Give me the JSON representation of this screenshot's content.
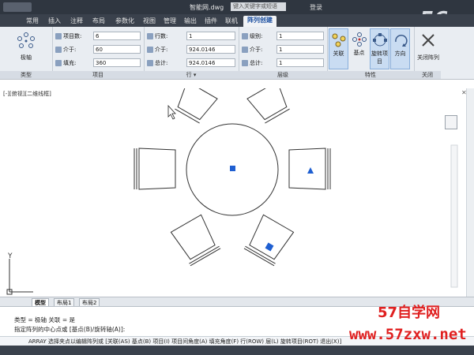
{
  "titlebar": {
    "doc_title": "智能网.dwg",
    "search_placeholder": "键入关键字或短语",
    "user_label": "登录"
  },
  "watermark_logo": {
    "num": "56",
    "text": "我乐"
  },
  "tabs": [
    "常用",
    "插入",
    "注释",
    "布局",
    "参数化",
    "视图",
    "管理",
    "输出",
    "插件",
    "联机",
    "阵列创建"
  ],
  "ribbon": {
    "type_group": {
      "label": "类型",
      "button": "极轴"
    },
    "items_group": {
      "label": "项目",
      "count_label": "项目数:",
      "count_value": "6",
      "between_label": "介于:",
      "between_value": "60",
      "fill_label": "填充:",
      "fill_value": "360"
    },
    "rows_group": {
      "label": "行 ▾",
      "rows_label": "行数:",
      "rows_value": "1",
      "between_label": "介于:",
      "between_value": "924.0146",
      "total_label": "总计:",
      "total_value": "924.0146"
    },
    "levels_group": {
      "label": "层级",
      "levels_label": "级别:",
      "levels_value": "1",
      "between_label": "介于:",
      "between_value": "1",
      "total_label": "总计:",
      "total_value": "1"
    },
    "props_group": {
      "label": "特性",
      "buttons": [
        "关联",
        "基点",
        "旋转项目",
        "方向"
      ]
    },
    "close_group": {
      "label": "关闭",
      "button": "关闭阵列"
    }
  },
  "viewport": {
    "label": "[-][俯视][二维线框]"
  },
  "layout_tabs": [
    "模型",
    "布局1",
    "布局2"
  ],
  "command": {
    "line1": "类型 = 极轴  关联 = 是",
    "line2": "指定阵列的中心点或 [基点(B)/旋转轴(A)]:",
    "line3": "ARRAY 选择夹点以编辑阵列或 [关联(AS) 基点(B) 项目(I) 项目间角度(A) 填充角度(F) 行(ROW) 层(L) 旋转项目(ROT) 退出(X)]"
  },
  "axis_label": "Y",
  "watermark": {
    "line1": "57自学网",
    "line2": "www.57zxw.net"
  }
}
